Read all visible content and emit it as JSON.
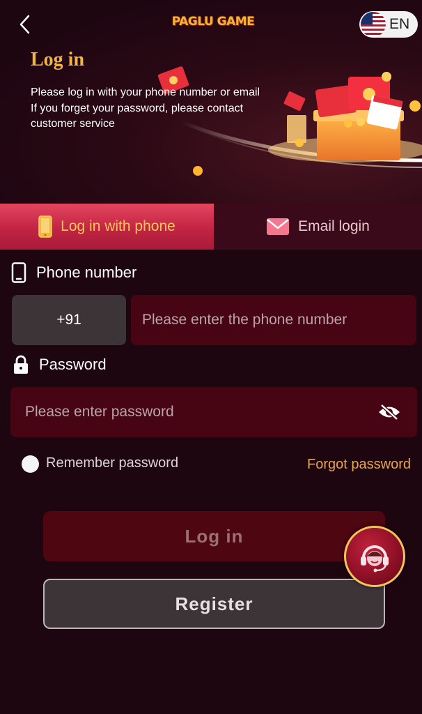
{
  "header": {
    "logo_text": "PAGLU GAME",
    "language": "EN"
  },
  "hero": {
    "title": "Log in",
    "line1": "Please log in with your phone number or email",
    "line2": "If you forget your password, please contact",
    "line3": "customer service"
  },
  "tabs": [
    {
      "label": "Log in with phone",
      "icon": "phone-icon",
      "active": true
    },
    {
      "label": "Email login",
      "icon": "mail-icon",
      "active": false
    }
  ],
  "form": {
    "phone_label": "Phone number",
    "country_code": "+91",
    "phone_placeholder": "Please enter the phone number",
    "phone_value": "",
    "password_label": "Password",
    "password_placeholder": "Please enter password",
    "password_value": "",
    "remember_label": "Remember password",
    "remember_checked": false,
    "forgot_label": "Forgot password"
  },
  "buttons": {
    "login": "Log in",
    "register": "Register"
  },
  "colors": {
    "background": "#1e0611",
    "accent_gold": "#f0b545",
    "active_tab": "#c22443",
    "input_bg": "#470413",
    "login_btn": "#4e0611",
    "register_btn": "#3d3438"
  }
}
